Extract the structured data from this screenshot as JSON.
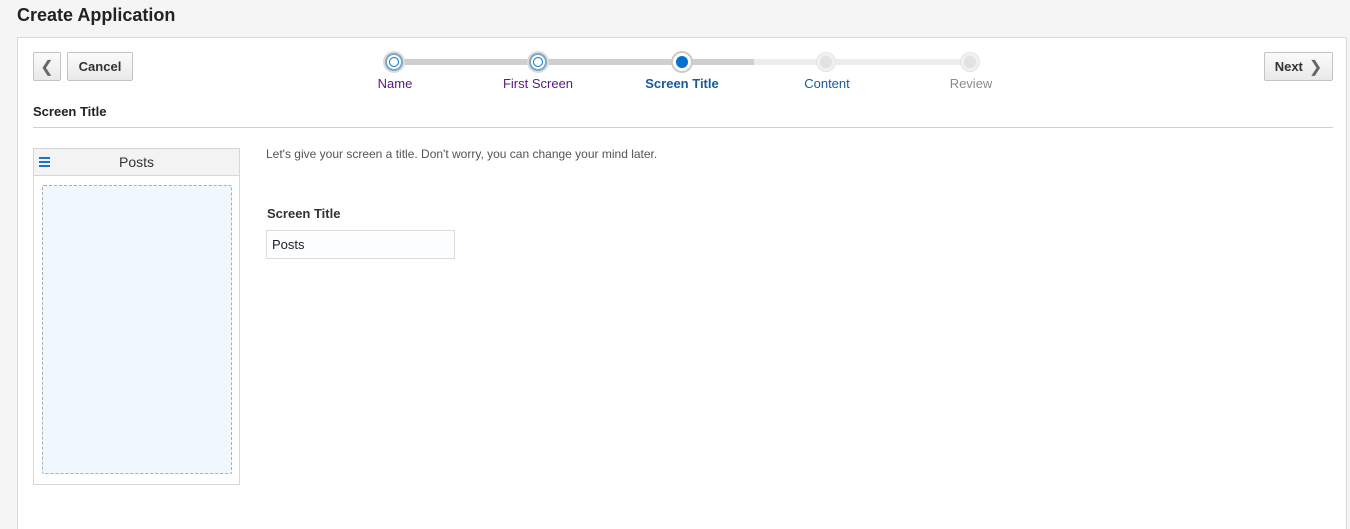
{
  "header": {
    "title": "Create Application"
  },
  "toolbar": {
    "back_icon": "chevron-left-icon",
    "cancel_label": "Cancel",
    "next_label": "Next",
    "next_icon": "chevron-right-icon"
  },
  "train": {
    "stops": [
      {
        "label": "Name",
        "state": "visited"
      },
      {
        "label": "First Screen",
        "state": "visited"
      },
      {
        "label": "Screen Title",
        "state": "current"
      },
      {
        "label": "Content",
        "state": "unvisited"
      },
      {
        "label": "Review",
        "state": "disabled"
      }
    ],
    "colors": {
      "current": "#0572ce",
      "visited_label": "#551a8b",
      "link": "#145c9e"
    }
  },
  "section": {
    "title": "Screen Title"
  },
  "preview": {
    "menu_icon": "hamburger-menu-icon",
    "title": "Posts"
  },
  "form": {
    "intro": "Let's give your screen a title. Don't worry, you can change your mind later.",
    "screen_title_label": "Screen Title",
    "screen_title_value": "Posts"
  }
}
